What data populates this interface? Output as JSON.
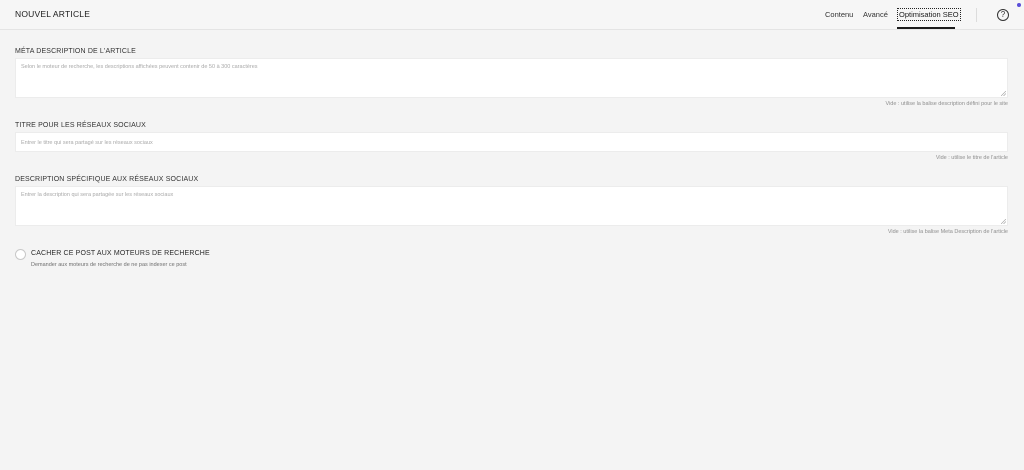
{
  "header": {
    "title": "NOUVEL ARTICLE",
    "tabs": [
      {
        "label": "Contenu"
      },
      {
        "label": "Avancé"
      },
      {
        "label": "Optimisation SEO"
      }
    ],
    "help_icon": "question-circle-icon",
    "accent_color": "#5b4fd9"
  },
  "form": {
    "meta_description": {
      "label": "MÉTA DESCRIPTION DE L'ARTICLE",
      "placeholder": "Selon le moteur de recherche, les descriptions affichées peuvent contenir de 50 à 300 caractères",
      "value": "",
      "helper": "Vide : utilise la balise description défini pour le site"
    },
    "social_title": {
      "label": "TITRE POUR LES RÉSEAUX SOCIAUX",
      "placeholder": "Entrer le titre qui sera partagé sur les réseaux sociaux",
      "value": "",
      "helper": "Vide : utilise le titre de l'article"
    },
    "social_description": {
      "label": "DESCRIPTION SPÉCIFIQUE AUX RÉSEAUX SOCIAUX",
      "placeholder": "Entrer la description qui sera partagée sur les réseaux sociaux",
      "value": "",
      "helper": "Vide : utilise la balise Meta Description de l'article"
    },
    "hide_post": {
      "label": "CACHER CE POST AUX MOTEURS DE RECHERCHE",
      "description": "Demander aux moteurs de recherche de ne pas indexer ce post",
      "checked": false
    }
  }
}
